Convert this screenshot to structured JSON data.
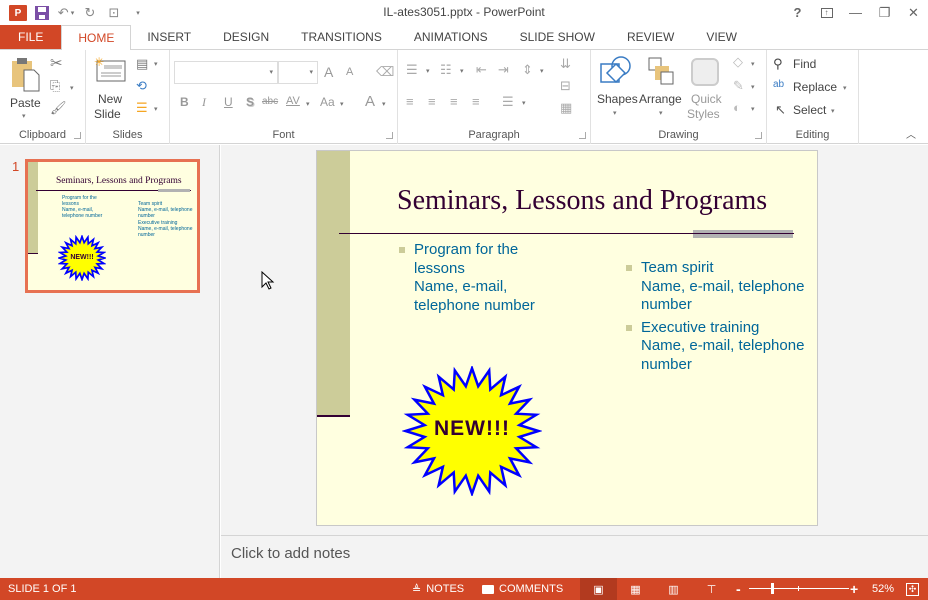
{
  "window": {
    "title": "IL-ates3051.pptx - PowerPoint",
    "controls": {
      "help": "?",
      "ribbon_display": "⊼",
      "minimize": "—",
      "restore": "❐",
      "close": "✕"
    }
  },
  "quick_access": {
    "app_icon": "P",
    "undo": "↶",
    "redo": "↻",
    "start_from_beginning": "⊡",
    "customize": "="
  },
  "tabs": [
    {
      "label": "FILE"
    },
    {
      "label": "HOME"
    },
    {
      "label": "INSERT"
    },
    {
      "label": "DESIGN"
    },
    {
      "label": "TRANSITIONS"
    },
    {
      "label": "ANIMATIONS"
    },
    {
      "label": "SLIDE SHOW"
    },
    {
      "label": "REVIEW"
    },
    {
      "label": "VIEW"
    }
  ],
  "ribbon": {
    "clipboard": {
      "label": "Clipboard",
      "paste": "Paste"
    },
    "slides": {
      "label": "Slides",
      "new_slide_line1": "New",
      "new_slide_line2": "Slide"
    },
    "font": {
      "label": "Font",
      "font_name": "",
      "font_size": "",
      "bold": "B",
      "italic": "I",
      "underline": "U",
      "shadow": "S",
      "strike": "abc",
      "spacing": "AV",
      "case": "Aa",
      "color": "A",
      "grow": "A",
      "shrink": "A"
    },
    "paragraph": {
      "label": "Paragraph"
    },
    "drawing": {
      "label": "Drawing",
      "shapes": "Shapes",
      "arrange": "Arrange",
      "quick_styles_line1": "Quick",
      "quick_styles_line2": "Styles"
    },
    "editing": {
      "label": "Editing",
      "find": "Find",
      "replace": "Replace",
      "select": "Select"
    }
  },
  "thumbnails": [
    {
      "number": "1",
      "selected": true
    }
  ],
  "slide": {
    "title": "Seminars, Lessons and Programs",
    "left_bullets": [
      {
        "lines": [
          "Program for the",
          "lessons",
          "Name, e-mail,",
          "telephone number"
        ]
      }
    ],
    "right_bullets": [
      {
        "lines": [
          "Team spirit",
          "Name, e-mail, telephone",
          "number"
        ]
      },
      {
        "lines": [
          "Executive training",
          "Name, e-mail, telephone",
          "number"
        ]
      }
    ],
    "starburst_text": "NEW!!!",
    "colors": {
      "background": "#ffffe0",
      "accent_bar": "#cccc99",
      "title": "#330033",
      "body": "#006699",
      "starburst_fill": "#ffff00",
      "starburst_stroke": "#0000ff"
    }
  },
  "notes": {
    "placeholder": "Click to add notes"
  },
  "status": {
    "slide_indicator": "SLIDE 1 OF 1",
    "notes": "NOTES",
    "comments": "COMMENTS",
    "zoom_minus": "-",
    "zoom_plus": "+",
    "zoom_level": "52%",
    "zoom_percent": 52
  }
}
